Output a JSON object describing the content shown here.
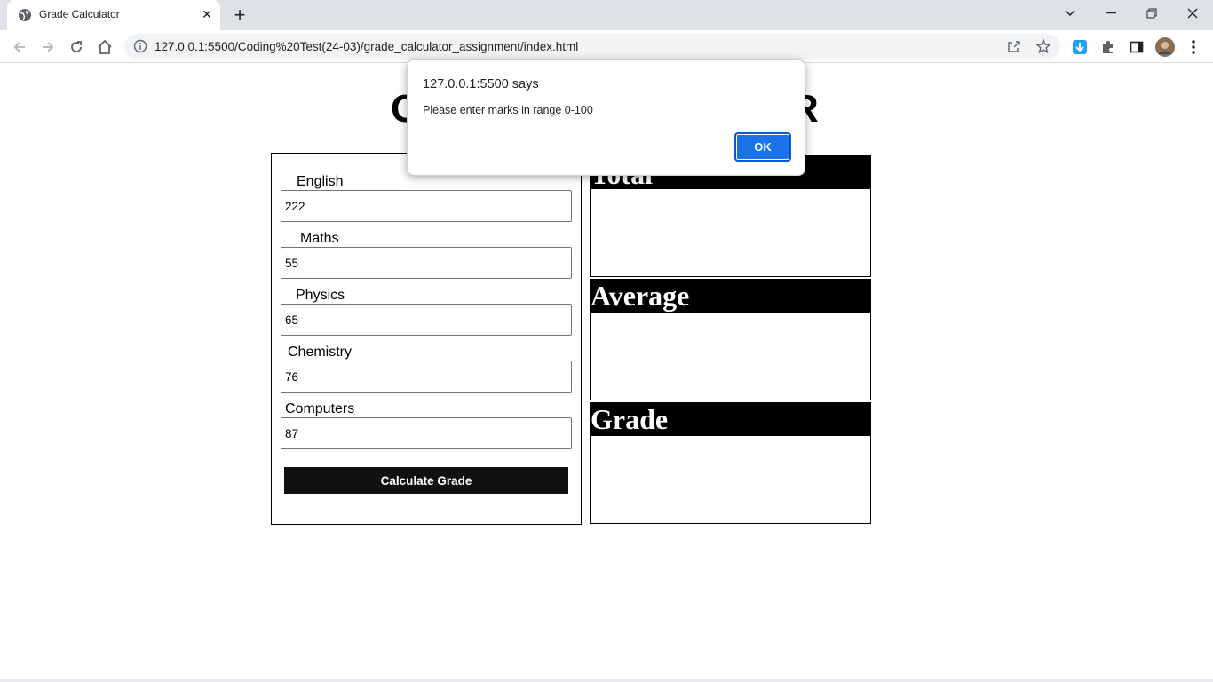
{
  "browser": {
    "tab_title": "Grade Calculator",
    "tab_close": "✕",
    "new_tab": "+",
    "url": "127.0.0.1:5500/Coding%20Test(24-03)/grade_calculator_assignment/index.html"
  },
  "page": {
    "heading_left": "G",
    "heading_right": "R"
  },
  "form": {
    "fields": [
      {
        "label": "English",
        "value": "222"
      },
      {
        "label": "Maths",
        "value": "55"
      },
      {
        "label": "Physics",
        "value": "65"
      },
      {
        "label": "Chemistry",
        "value": "76"
      },
      {
        "label": "Computers",
        "value": "87"
      }
    ],
    "button_label": "Calculate Grade"
  },
  "results": {
    "total_label": "Total",
    "average_label": "Average",
    "grade_label": "Grade"
  },
  "alert": {
    "origin": "127.0.0.1:5500 says",
    "message": "Please enter marks in range 0-100",
    "ok_label": "OK"
  },
  "colors": {
    "alert_button": "#1a73e8",
    "result_header": "#000000",
    "calc_button": "#111111"
  }
}
